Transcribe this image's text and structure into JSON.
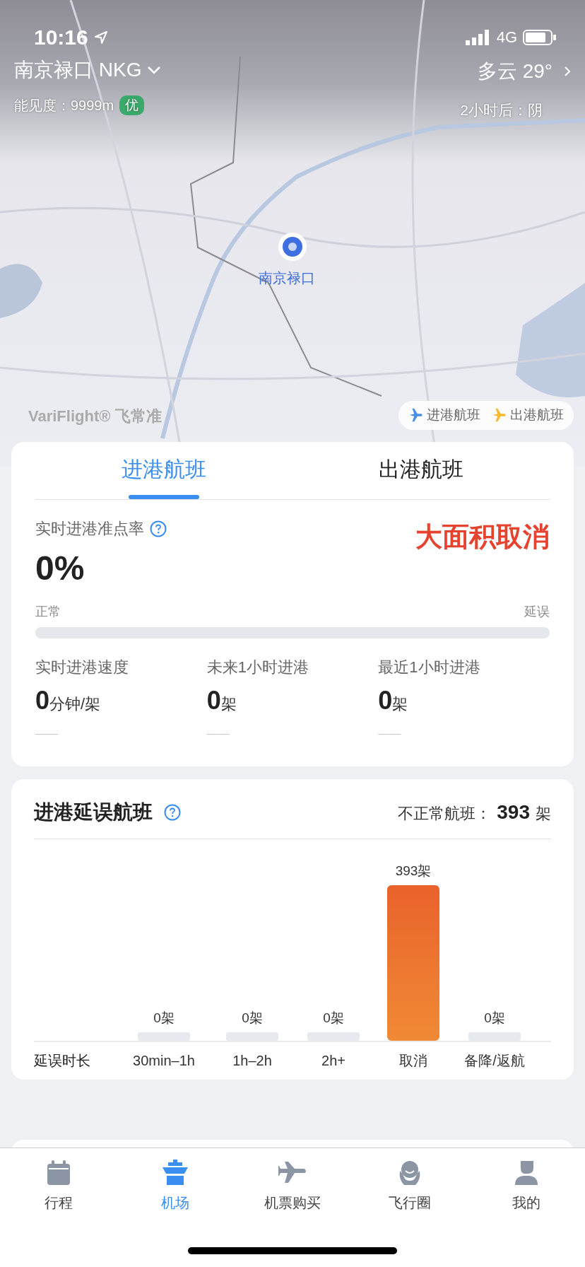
{
  "status_bar": {
    "time": "10:16",
    "network": "4G"
  },
  "header": {
    "airport": "南京禄口 NKG",
    "visibility_label": "能见度：9999m",
    "air_quality": "优",
    "weather": "多云 29°",
    "forecast": "2小时后：阴"
  },
  "map": {
    "kind": "picture",
    "pin_label": "南京禄口",
    "brand": "VariFlight® 飞常准",
    "legend": [
      {
        "label": "进港航班",
        "color": "#4a90e2"
      },
      {
        "label": "出港航班",
        "color": "#f5b82e"
      }
    ]
  },
  "flight_tabs": [
    {
      "label": "进港航班",
      "selected": true
    },
    {
      "label": "出港航班",
      "selected": false
    }
  ],
  "punctuality": {
    "label": "实时进港准点率",
    "value": "0%",
    "alert": "大面积取消",
    "bar_left": "正常",
    "bar_right": "延误",
    "level": 0
  },
  "stats": [
    {
      "label": "实时进港速度",
      "value": "0",
      "unit": "分钟/架",
      "trend": "——"
    },
    {
      "label": "未来1小时进港",
      "value": "0",
      "unit": "架",
      "trend": "——"
    },
    {
      "label": "最近1小时进港",
      "value": "0",
      "unit": "架",
      "trend": "——"
    }
  ],
  "delay_card": {
    "title": "进港延误航班",
    "summary_label": "不正常航班：",
    "summary_value": "393",
    "summary_unit": "架",
    "chart_data": {
      "type": "bar",
      "xlabel": "延误时长",
      "categories": [
        "30min–1h",
        "1h–2h",
        "2h+",
        "取消",
        "备降/返航"
      ],
      "values": [
        0,
        0,
        0,
        393,
        0
      ],
      "value_labels": [
        "0架",
        "0架",
        "0架",
        "393架",
        "0架"
      ]
    }
  },
  "bottom_tabs": [
    {
      "label": "行程",
      "selected": false
    },
    {
      "label": "机场",
      "selected": true
    },
    {
      "label": "机票购买",
      "selected": false
    },
    {
      "label": "飞行圈",
      "selected": false
    },
    {
      "label": "我的",
      "selected": false
    }
  ]
}
